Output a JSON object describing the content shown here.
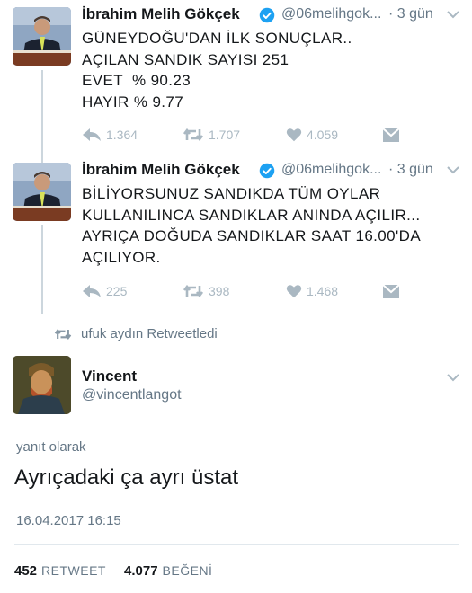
{
  "tweets": [
    {
      "name": "İbrahim Melih Gökçek",
      "handle": "@06melihgok...",
      "time": "· 3 gün",
      "lines": [
        "GÜNEYDOĞU'DAN İLK SONUÇLAR..",
        "AÇILAN SANDIK SAYISI 251",
        "EVET  % 90.23",
        "HAYIR % 9.77"
      ],
      "replies": "1.364",
      "retweets": "1.707",
      "likes": "4.059"
    },
    {
      "name": "İbrahim Melih Gökçek",
      "handle": "@06melihgok...",
      "time": "· 3 gün",
      "lines": [
        "BİLİYORSUNUZ SANDIKDA TÜM OYLAR",
        "KULLANILINCA SANDIKLAR ANINDA AÇILIR...",
        "AYRIÇA DOĞUDA SANDIKLAR SAAT 16.00'DA",
        "AÇILIYOR."
      ],
      "replies": "225",
      "retweets": "398",
      "likes": "1.468"
    }
  ],
  "retweet_context": "ufuk aydın Retweetledi",
  "main_tweet": {
    "name": "Vincent",
    "handle": "@vincentlangot",
    "reply_label": "yanıt olarak",
    "text": "Ayrıçadaki ça ayrı üstat",
    "timestamp": "16.04.2017 16:15",
    "retweet_count": "452",
    "retweet_label": "RETWEET",
    "like_count": "4.077",
    "like_label": "BEĞENİ"
  },
  "icons": {
    "verified": "verified-badge-icon",
    "reply": "reply-icon",
    "retweet": "retweet-icon",
    "like": "heart-icon",
    "dm": "envelope-icon",
    "more": "chevron-down-icon"
  },
  "colors": {
    "verified": "#1da1f2",
    "action": "#aab8c2",
    "text": "#14171a",
    "muted": "#657786"
  }
}
